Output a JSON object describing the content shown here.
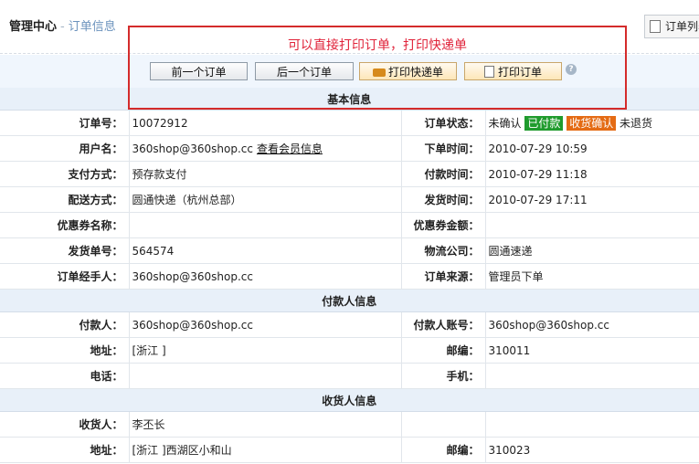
{
  "header": {
    "title": "管理中心",
    "separator": "-",
    "subtitle": "订单信息",
    "list_button": "订单列表"
  },
  "annotation": "可以直接打印订单，打印快递单",
  "toolbar": {
    "prev": "前一个订单",
    "next": "后一个订单",
    "print_express": "打印快递单",
    "print_order": "打印订单",
    "help": "?"
  },
  "sections": {
    "basic": "基本信息",
    "payer": "付款人信息",
    "consignee": "收货人信息"
  },
  "basic": {
    "order_no_label": "订单号：",
    "order_no": "10072912",
    "status_label": "订单状态：",
    "status_unconfirmed": "未确认",
    "status_paid": "已付款",
    "status_received": "收货确认",
    "status_noreturn": "未退货",
    "user_label": "用户名：",
    "user": "360shop@360shop.cc",
    "user_link": "查看会员信息",
    "order_time_label": "下单时间：",
    "order_time": "2010-07-29 10:59",
    "payment_label": "支付方式：",
    "payment": "预存款支付",
    "pay_time_label": "付款时间：",
    "pay_time": "2010-07-29 11:18",
    "shipping_label": "配送方式：",
    "shipping": "圆通快递（杭州总部）",
    "ship_time_label": "发货时间：",
    "ship_time": "2010-07-29 17:11",
    "coupon_name_label": "优惠券名称：",
    "coupon_amount_label": "优惠券金额：",
    "ship_no_label": "发货单号：",
    "ship_no": "564574",
    "logistics_label": "物流公司：",
    "logistics": "圆通速递",
    "handler_label": "订单经手人：",
    "handler": "360shop@360shop.cc",
    "source_label": "订单来源：",
    "source": "管理员下单"
  },
  "payer": {
    "name_label": "付款人：",
    "name": "360shop@360shop.cc",
    "account_label": "付款人账号：",
    "account": "360shop@360shop.cc",
    "address_label": "地址：",
    "address": "[浙江 ]",
    "zip_label": "邮编：",
    "zip": "310011",
    "phone_label": "电话：",
    "mobile_label": "手机："
  },
  "consignee": {
    "name_label": "收货人：",
    "name": "李丕长",
    "address_label": "地址：",
    "address": "[浙江 ]西湖区小和山",
    "zip_label": "邮编：",
    "zip": "310023"
  }
}
